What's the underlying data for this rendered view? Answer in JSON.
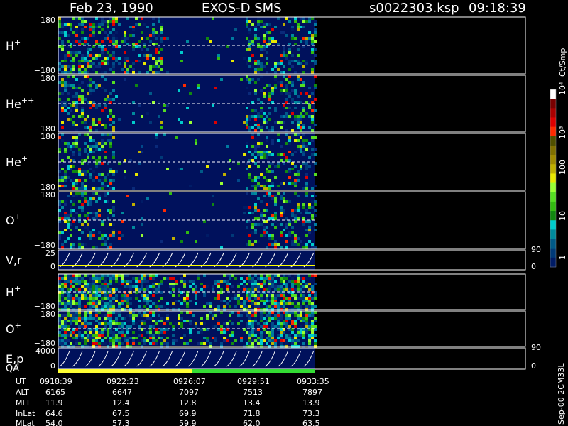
{
  "header": {
    "date": "Feb 23, 1990",
    "instrument": "EXOS-D SMS",
    "file": "s0022303.ksp",
    "time": "09:18:39"
  },
  "colors": {
    "background": "#000000",
    "panel_fill": "#00115c",
    "panel_border": "#ffffff",
    "dashed_line": "#ffffff",
    "qa_bar_yellow": "#ffff33",
    "qa_bar_green": "#33dd33",
    "angle_trace": "#ffff00"
  },
  "chart_data": {
    "type": "heatmap",
    "title": "Feb 23, 1990   EXOS-D SMS",
    "panels": [
      {
        "id": "hplus-1",
        "label": "H",
        "sup": "+",
        "ymax": "180",
        "ymin": "−180"
      },
      {
        "id": "hepp",
        "label": "He",
        "sup": "++",
        "ymax": "180",
        "ymin": "−180"
      },
      {
        "id": "heplus",
        "label": "He",
        "sup": "+",
        "ymax": "180",
        "ymin": "−180"
      },
      {
        "id": "oplus-1",
        "label": "O",
        "sup": "+",
        "ymax": "180",
        "ymin": "−180"
      },
      {
        "id": "vr",
        "label": "V,r",
        "sup": "",
        "ymax": "25",
        "ymin": "0",
        "right_max": "90",
        "right_min": "0"
      },
      {
        "id": "hplus-2",
        "label": "H",
        "sup": "+",
        "ymax": "",
        "ymin": "−180"
      },
      {
        "id": "oplus-2",
        "label": "O",
        "sup": "+",
        "ymax": "180",
        "ymin": "−180"
      },
      {
        "id": "ep",
        "label": "E,p",
        "sup": "",
        "ymax": "4000",
        "ymin": "0",
        "right_max": "90",
        "right_min": "0"
      }
    ],
    "qa_label": "QA",
    "colorbar": {
      "unit": "Ct/Smp",
      "tick_labels": [
        "10⁴",
        "10³",
        "100",
        "10",
        "1"
      ],
      "colors": [
        "#ffffff",
        "#7a0000",
        "#aa0000",
        "#dd0000",
        "#ff2a00",
        "#505000",
        "#807000",
        "#a08a00",
        "#c0b000",
        "#e8e800",
        "#99ff33",
        "#55dd22",
        "#33bb11",
        "#118811",
        "#00cccc",
        "#008a9c",
        "#005a88",
        "#003a78",
        "#001c66"
      ]
    },
    "time_axis": {
      "row_labels": [
        "UT",
        "ALT",
        "MLT",
        "InLat",
        "MLat"
      ],
      "columns": [
        {
          "ut": "0918:39",
          "alt": "6165",
          "mlt": "11.9",
          "inlat": "64.6",
          "mlat": "54.0"
        },
        {
          "ut": "0922:23",
          "alt": "6647",
          "mlt": "12.4",
          "inlat": "67.5",
          "mlat": "57.3"
        },
        {
          "ut": "0926:07",
          "alt": "7097",
          "mlt": "12.8",
          "inlat": "69.9",
          "mlat": "59.9"
        },
        {
          "ut": "0929:51",
          "alt": "7513",
          "mlt": "13.4",
          "inlat": "71.8",
          "mlat": "62.0"
        },
        {
          "ut": "0933:35",
          "alt": "7897",
          "mlt": "13.9",
          "inlat": "73.3",
          "mlat": "63.5"
        }
      ]
    },
    "data_coverage_fraction": 0.55,
    "qa_yellow_fraction": 0.52
  },
  "footer_note": "Sep-00 2CM33L"
}
